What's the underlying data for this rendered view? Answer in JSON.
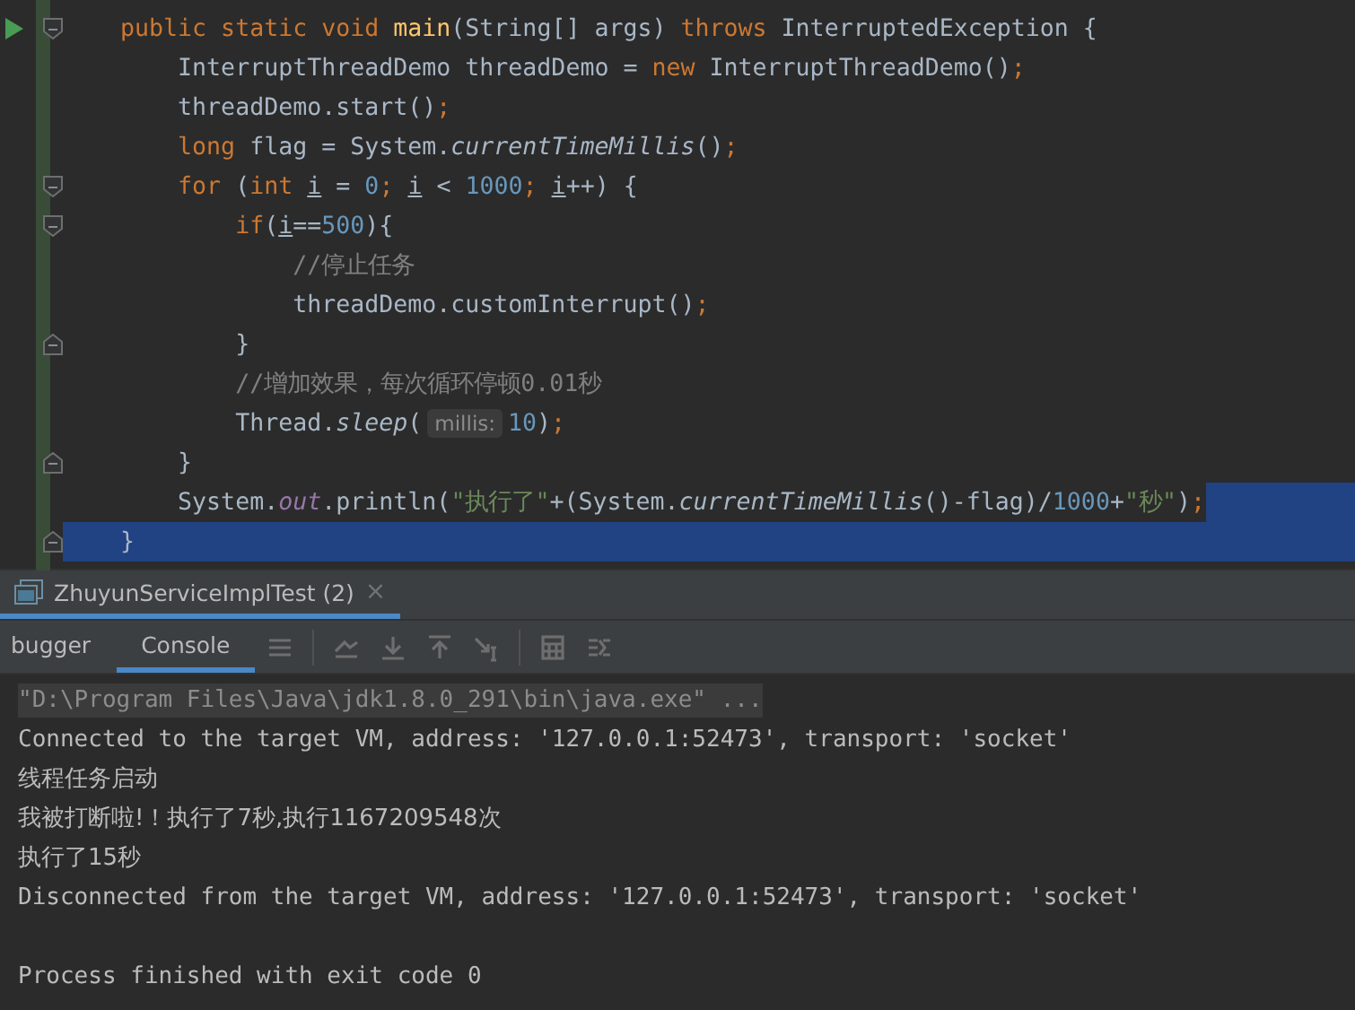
{
  "editor": {
    "lines": [
      {
        "run": true,
        "fold_start": true,
        "fold_end": false,
        "selected": false,
        "selected_after": false,
        "tokens": [
          {
            "kind": "keyword",
            "text": "    public static void "
          },
          {
            "kind": "method",
            "text": "main"
          },
          {
            "kind": "plain",
            "text": "(String[] args) "
          },
          {
            "kind": "keyword",
            "text": "throws "
          },
          {
            "kind": "plain",
            "text": "InterruptedException {"
          }
        ]
      },
      {
        "fold_start": false,
        "fold_end": false,
        "selected": false,
        "selected_after": false,
        "tokens": [
          {
            "kind": "plain",
            "text": "        InterruptThreadDemo threadDemo = "
          },
          {
            "kind": "keyword",
            "text": "new "
          },
          {
            "kind": "plain",
            "text": "InterruptThreadDemo()"
          },
          {
            "kind": "keyword",
            "text": ";"
          }
        ]
      },
      {
        "fold_start": false,
        "fold_end": false,
        "selected": false,
        "selected_after": false,
        "tokens": [
          {
            "kind": "plain",
            "text": "        threadDemo.start()"
          },
          {
            "kind": "keyword",
            "text": ";"
          }
        ]
      },
      {
        "fold_start": false,
        "fold_end": false,
        "selected": false,
        "selected_after": false,
        "tokens": [
          {
            "kind": "keyword",
            "text": "        long "
          },
          {
            "kind": "plain",
            "text": "flag = System."
          },
          {
            "kind": "static",
            "text": "currentTimeMillis"
          },
          {
            "kind": "plain",
            "text": "()"
          },
          {
            "kind": "keyword",
            "text": ";"
          }
        ]
      },
      {
        "fold_start": true,
        "fold_end": false,
        "selected": false,
        "selected_after": false,
        "tokens": [
          {
            "kind": "keyword",
            "text": "        for "
          },
          {
            "kind": "plain",
            "text": "("
          },
          {
            "kind": "keyword",
            "text": "int "
          },
          {
            "kind": "var",
            "text": "i"
          },
          {
            "kind": "plain",
            "text": " = "
          },
          {
            "kind": "number",
            "text": "0"
          },
          {
            "kind": "keyword",
            "text": "; "
          },
          {
            "kind": "var",
            "text": "i"
          },
          {
            "kind": "plain",
            "text": " < "
          },
          {
            "kind": "number",
            "text": "1000"
          },
          {
            "kind": "keyword",
            "text": "; "
          },
          {
            "kind": "var",
            "text": "i"
          },
          {
            "kind": "plain",
            "text": "++) {"
          }
        ]
      },
      {
        "fold_start": true,
        "fold_end": false,
        "selected": false,
        "selected_after": false,
        "tokens": [
          {
            "kind": "keyword",
            "text": "            if"
          },
          {
            "kind": "plain",
            "text": "("
          },
          {
            "kind": "var",
            "text": "i"
          },
          {
            "kind": "plain",
            "text": "=="
          },
          {
            "kind": "number",
            "text": "500"
          },
          {
            "kind": "plain",
            "text": "){"
          }
        ]
      },
      {
        "fold_start": false,
        "fold_end": false,
        "selected": false,
        "selected_after": false,
        "tokens": [
          {
            "kind": "comment",
            "text": "                //停止任务"
          }
        ]
      },
      {
        "fold_start": false,
        "fold_end": false,
        "selected": false,
        "selected_after": false,
        "tokens": [
          {
            "kind": "plain",
            "text": "                threadDemo.customInterrupt()"
          },
          {
            "kind": "keyword",
            "text": ";"
          }
        ]
      },
      {
        "fold_start": false,
        "fold_end": true,
        "selected": false,
        "selected_after": false,
        "tokens": [
          {
            "kind": "plain",
            "text": "            }"
          }
        ]
      },
      {
        "fold_start": false,
        "fold_end": false,
        "selected": false,
        "selected_after": false,
        "tokens": [
          {
            "kind": "comment",
            "text": "            //增加效果，每次循环停顿0.01秒"
          }
        ]
      },
      {
        "fold_start": false,
        "fold_end": false,
        "selected": false,
        "selected_after": false,
        "tokens": [
          {
            "kind": "plain",
            "text": "            Thread."
          },
          {
            "kind": "static",
            "text": "sleep"
          },
          {
            "kind": "plain",
            "text": "("
          },
          {
            "kind": "hint",
            "text": "millis:"
          },
          {
            "kind": "number",
            "text": "10"
          },
          {
            "kind": "plain",
            "text": ")"
          },
          {
            "kind": "keyword",
            "text": ";"
          }
        ]
      },
      {
        "fold_start": false,
        "fold_end": true,
        "selected": false,
        "selected_after": false,
        "tokens": [
          {
            "kind": "plain",
            "text": "        }"
          }
        ]
      },
      {
        "fold_start": false,
        "fold_end": false,
        "selected": false,
        "selected_after": true,
        "tokens": [
          {
            "kind": "plain",
            "text": "        System."
          },
          {
            "kind": "field",
            "text": "out"
          },
          {
            "kind": "plain",
            "text": ".println("
          },
          {
            "kind": "string",
            "text": "\"执行了\""
          },
          {
            "kind": "plain",
            "text": "+(System."
          },
          {
            "kind": "static",
            "text": "currentTimeMillis"
          },
          {
            "kind": "plain",
            "text": "()-flag)/"
          },
          {
            "kind": "number",
            "text": "1000"
          },
          {
            "kind": "plain",
            "text": "+"
          },
          {
            "kind": "string",
            "text": "\"秒\""
          },
          {
            "kind": "plain",
            "text": ")"
          },
          {
            "kind": "keyword",
            "text": ";"
          }
        ]
      },
      {
        "fold_start": false,
        "fold_end": true,
        "selected": true,
        "selected_after": false,
        "tokens": [
          {
            "kind": "plain",
            "text": "    }"
          }
        ]
      }
    ]
  },
  "run_panel": {
    "tabs": [
      {
        "label": "ZhuyunServiceImplTest (2)",
        "selected": true,
        "close": "×"
      }
    ],
    "subtabs": [
      {
        "label": "bugger",
        "selected": false
      },
      {
        "label": "Console",
        "selected": true
      }
    ],
    "toolbar": [
      {
        "kind": "menu"
      },
      {
        "kind": "sep"
      },
      {
        "kind": "scroll-up"
      },
      {
        "kind": "down"
      },
      {
        "kind": "up"
      },
      {
        "kind": "cursor"
      },
      {
        "kind": "sep"
      },
      {
        "kind": "grid"
      },
      {
        "kind": "list"
      }
    ],
    "console": [
      {
        "kind": "command",
        "text": "\"D:\\Program Files\\Java\\jdk1.8.0_291\\bin\\java.exe\" ..."
      },
      {
        "kind": "system",
        "text": "Connected to the target VM, address: '127.0.0.1:52473', transport: 'socket'"
      },
      {
        "kind": "output",
        "text": "线程任务启动"
      },
      {
        "kind": "output",
        "text": "我被打断啦!！执行了7秒,执行1167209548次"
      },
      {
        "kind": "output",
        "text": "执行了15秒"
      },
      {
        "kind": "system",
        "text": "Disconnected from the target VM, address: '127.0.0.1:52473', transport: 'socket'"
      },
      {
        "kind": "exit",
        "text": "Process finished with exit code 0"
      }
    ]
  }
}
